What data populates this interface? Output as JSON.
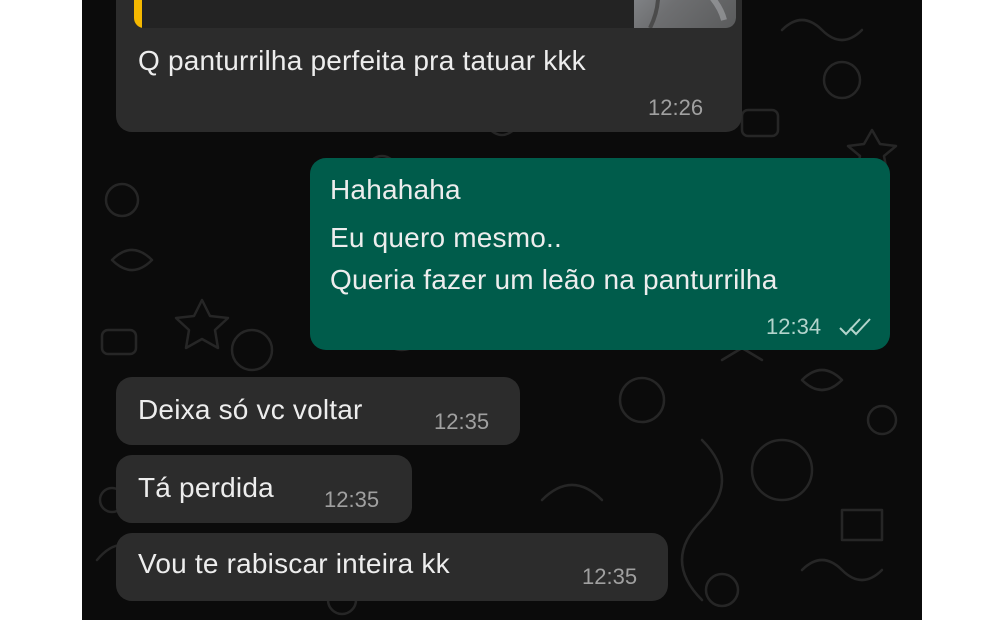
{
  "conversation": {
    "messages": [
      {
        "direction": "incoming",
        "text": "Q panturrilha perfeita pra tatuar kkk",
        "time": "12:26"
      },
      {
        "direction": "outgoing",
        "lines": [
          "Hahahaha",
          "Eu quero mesmo..",
          "Queria fazer um leão na panturrilha"
        ],
        "time": "12:34"
      },
      {
        "direction": "incoming",
        "text": "Deixa só vc voltar",
        "time": "12:35"
      },
      {
        "direction": "incoming",
        "text": "Tá perdida",
        "time": "12:35"
      },
      {
        "direction": "incoming",
        "text": "Vou te rabiscar inteira kk",
        "time": "12:35"
      }
    ]
  },
  "colors": {
    "chat_background": "#0b0b0b",
    "incoming_bubble": "#2c2c2c",
    "outgoing_bubble": "#005c4b",
    "quote_accent": "#f5b800",
    "read_ticks": "#b3d4cc"
  },
  "icons": {
    "read_status": "double-check-icon"
  }
}
